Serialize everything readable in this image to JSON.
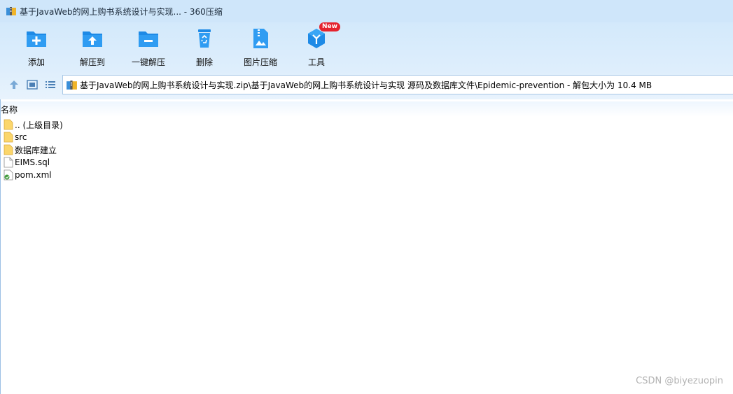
{
  "window": {
    "title": "基于JavaWeb的网上购书系统设计与实现... - 360压缩"
  },
  "colors": {
    "accent": "#1e8ae6",
    "titlebar_bg": "#cfe6fa",
    "badge_red": "#e5232e"
  },
  "toolbar": {
    "add_label": "添加",
    "extract_to_label": "解压到",
    "one_click_extract_label": "一键解压",
    "delete_label": "删除",
    "image_compress_label": "图片压缩",
    "tools_label": "工具",
    "new_badge": "New"
  },
  "address": {
    "path": "基于JavaWeb的网上购书系统设计与实现.zip\\基于JavaWeb的网上购书系统设计与实现 源码及数据库文件\\Epidemic-prevention - 解包大小为 10.4 MB"
  },
  "columns": {
    "name": "名称"
  },
  "files": [
    {
      "name": ".. (上级目录)",
      "icon": "folder-icon"
    },
    {
      "name": "src",
      "icon": "folder-icon"
    },
    {
      "name": "数据库建立",
      "icon": "folder-icon"
    },
    {
      "name": "EIMS.sql",
      "icon": "file-icon"
    },
    {
      "name": "pom.xml",
      "icon": "xml-file-icon"
    }
  ],
  "watermark": "CSDN @biyezuopin"
}
